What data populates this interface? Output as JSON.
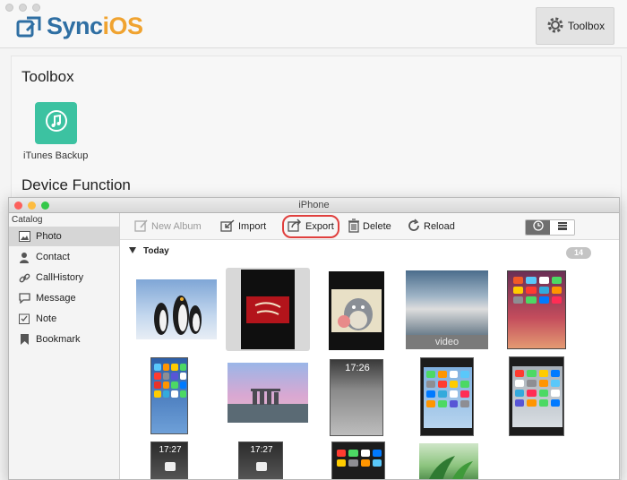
{
  "app": {
    "brand_part1": "Sync",
    "brand_part2": "iOS"
  },
  "header": {
    "toolbox_label": "Toolbox"
  },
  "main": {
    "toolbox_title": "Toolbox",
    "tool_itunes_label": "iTunes Backup",
    "device_function_title": "Device Function"
  },
  "dialog": {
    "title": "iPhone",
    "catalog_label": "Catalog",
    "sidebar_items": [
      {
        "label": "Photo",
        "icon": "photo-icon",
        "active": true
      },
      {
        "label": "Contact",
        "icon": "contact-icon",
        "active": false
      },
      {
        "label": "CallHistory",
        "icon": "link-icon",
        "active": false
      },
      {
        "label": "Message",
        "icon": "message-icon",
        "active": false
      },
      {
        "label": "Note",
        "icon": "note-icon",
        "active": false
      },
      {
        "label": "Bookmark",
        "icon": "bookmark-icon",
        "active": false
      }
    ],
    "toolbar": {
      "new_album": "New Album",
      "import": "Import",
      "export": "Export",
      "delete": "Delete",
      "reload": "Reload"
    },
    "group": {
      "name": "Today",
      "count": "14"
    },
    "thumb_text": {
      "video_label": "video",
      "time1": "17:26",
      "time2": "17:27",
      "time3": "17:27"
    }
  },
  "colors": {
    "brand_blue": "#2f6fa3",
    "brand_orange": "#f0a330",
    "itunes_tile": "#3cc2a1",
    "export_highlight": "#e0403e",
    "dot_close": "#fc605c",
    "dot_min": "#fdbc40",
    "dot_max": "#34c84a"
  }
}
